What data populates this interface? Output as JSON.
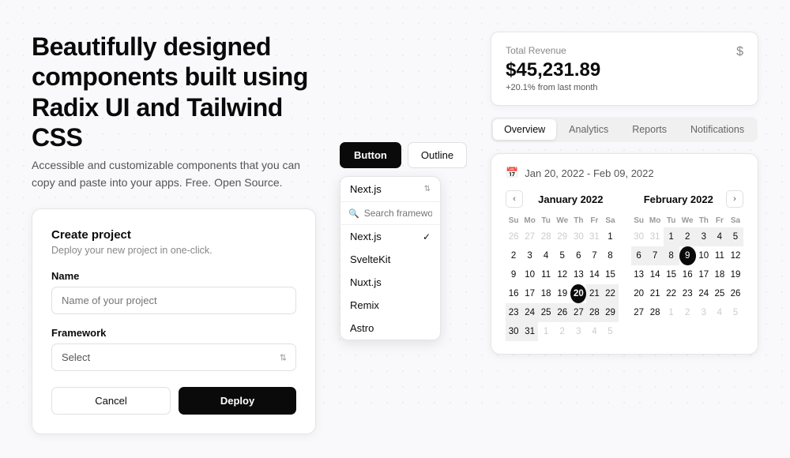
{
  "hero": {
    "title": "Beautifully designed components built using Radix UI and Tailwind CSS",
    "subtitle": "Accessible and customizable components that you can copy and paste into your apps. Free. Open Source."
  },
  "create_card": {
    "title": "Create project",
    "subtitle": "Deploy your new project in one-click.",
    "name_label": "Name",
    "name_placeholder": "Name of your project",
    "framework_label": "Framework",
    "framework_placeholder": "Select",
    "cancel_label": "Cancel",
    "deploy_label": "Deploy"
  },
  "buttons": {
    "solid_label": "Button",
    "outline_label": "Outline"
  },
  "dropdown": {
    "trigger_label": "Next.js",
    "search_placeholder": "Search framework...",
    "items": [
      {
        "label": "Next.js",
        "selected": true
      },
      {
        "label": "SvelteKit",
        "selected": false
      },
      {
        "label": "Nuxt.js",
        "selected": false
      },
      {
        "label": "Remix",
        "selected": false
      },
      {
        "label": "Astro",
        "selected": false
      }
    ]
  },
  "revenue": {
    "label": "Total Revenue",
    "amount": "$45,231.89",
    "change": "+20.1% from last month",
    "icon": "$"
  },
  "tabs": {
    "items": [
      {
        "label": "Overview",
        "active": true
      },
      {
        "label": "Analytics",
        "active": false
      },
      {
        "label": "Reports",
        "active": false
      },
      {
        "label": "Notifications",
        "active": false
      }
    ]
  },
  "calendar": {
    "date_range": "Jan 20, 2022 - Feb 09, 2022",
    "january": {
      "title": "January 2022",
      "days_header": [
        "Su",
        "Mo",
        "Tu",
        "We",
        "Th",
        "Fr",
        "Sa"
      ],
      "weeks": [
        [
          {
            "day": "26",
            "other": true
          },
          {
            "day": "27",
            "other": true
          },
          {
            "day": "28",
            "other": true
          },
          {
            "day": "29",
            "other": true
          },
          {
            "day": "30",
            "other": true
          },
          {
            "day": "31",
            "other": true
          },
          {
            "day": "1",
            "other": false
          }
        ],
        [
          {
            "day": "2",
            "other": false
          },
          {
            "day": "3",
            "other": false
          },
          {
            "day": "4",
            "other": false
          },
          {
            "day": "5",
            "other": false
          },
          {
            "day": "6",
            "other": false
          },
          {
            "day": "7",
            "other": false
          },
          {
            "day": "8",
            "other": false
          }
        ],
        [
          {
            "day": "9",
            "other": false
          },
          {
            "day": "10",
            "other": false
          },
          {
            "day": "11",
            "other": false
          },
          {
            "day": "12",
            "other": false
          },
          {
            "day": "13",
            "other": false
          },
          {
            "day": "14",
            "other": false
          },
          {
            "day": "15",
            "other": false
          }
        ],
        [
          {
            "day": "16",
            "other": false
          },
          {
            "day": "17",
            "other": false
          },
          {
            "day": "18",
            "other": false
          },
          {
            "day": "19",
            "other": false
          },
          {
            "day": "20",
            "other": false,
            "range_start": true
          },
          {
            "day": "21",
            "other": false,
            "range": true
          },
          {
            "day": "22",
            "other": false,
            "range": true
          }
        ],
        [
          {
            "day": "23",
            "other": false,
            "range": true
          },
          {
            "day": "24",
            "other": false,
            "range": true
          },
          {
            "day": "25",
            "other": false,
            "range": true
          },
          {
            "day": "26",
            "other": false,
            "range": true
          },
          {
            "day": "27",
            "other": false,
            "range": true
          },
          {
            "day": "28",
            "other": false,
            "range": true
          },
          {
            "day": "29",
            "other": false,
            "range": true
          }
        ],
        [
          {
            "day": "30",
            "other": false,
            "range": true
          },
          {
            "day": "31",
            "other": false,
            "range": true
          },
          {
            "day": "1",
            "other": true
          },
          {
            "day": "2",
            "other": true
          },
          {
            "day": "3",
            "other": true
          },
          {
            "day": "4",
            "other": true
          },
          {
            "day": "5",
            "other": true
          }
        ]
      ]
    },
    "february": {
      "title": "February 2022",
      "days_header": [
        "Su",
        "Mo",
        "Tu",
        "We",
        "Th",
        "Fr",
        "Sa"
      ],
      "weeks": [
        [
          {
            "day": "30",
            "other": true
          },
          {
            "day": "31",
            "other": true
          },
          {
            "day": "1",
            "other": false,
            "range": true
          },
          {
            "day": "2",
            "other": false,
            "range": true
          },
          {
            "day": "3",
            "other": false,
            "range": true
          },
          {
            "day": "4",
            "other": false,
            "range": true
          },
          {
            "day": "5",
            "other": false,
            "range": true
          }
        ],
        [
          {
            "day": "6",
            "other": false,
            "range": true
          },
          {
            "day": "7",
            "other": false,
            "range": true
          },
          {
            "day": "8",
            "other": false,
            "range": true
          },
          {
            "day": "9",
            "other": false,
            "selected": true
          },
          {
            "day": "10",
            "other": false
          },
          {
            "day": "11",
            "other": false
          },
          {
            "day": "12",
            "other": false
          }
        ],
        [
          {
            "day": "13",
            "other": false
          },
          {
            "day": "14",
            "other": false
          },
          {
            "day": "15",
            "other": false
          },
          {
            "day": "16",
            "other": false
          },
          {
            "day": "17",
            "other": false
          },
          {
            "day": "18",
            "other": false
          },
          {
            "day": "19",
            "other": false
          }
        ],
        [
          {
            "day": "20",
            "other": false
          },
          {
            "day": "21",
            "other": false
          },
          {
            "day": "22",
            "other": false
          },
          {
            "day": "23",
            "other": false
          },
          {
            "day": "24",
            "other": false
          },
          {
            "day": "25",
            "other": false
          },
          {
            "day": "26",
            "other": false
          }
        ],
        [
          {
            "day": "27",
            "other": false
          },
          {
            "day": "28",
            "other": false
          },
          {
            "day": "1",
            "other": true
          },
          {
            "day": "2",
            "other": true
          },
          {
            "day": "3",
            "other": true
          },
          {
            "day": "4",
            "other": true
          },
          {
            "day": "5",
            "other": true
          }
        ]
      ]
    }
  }
}
